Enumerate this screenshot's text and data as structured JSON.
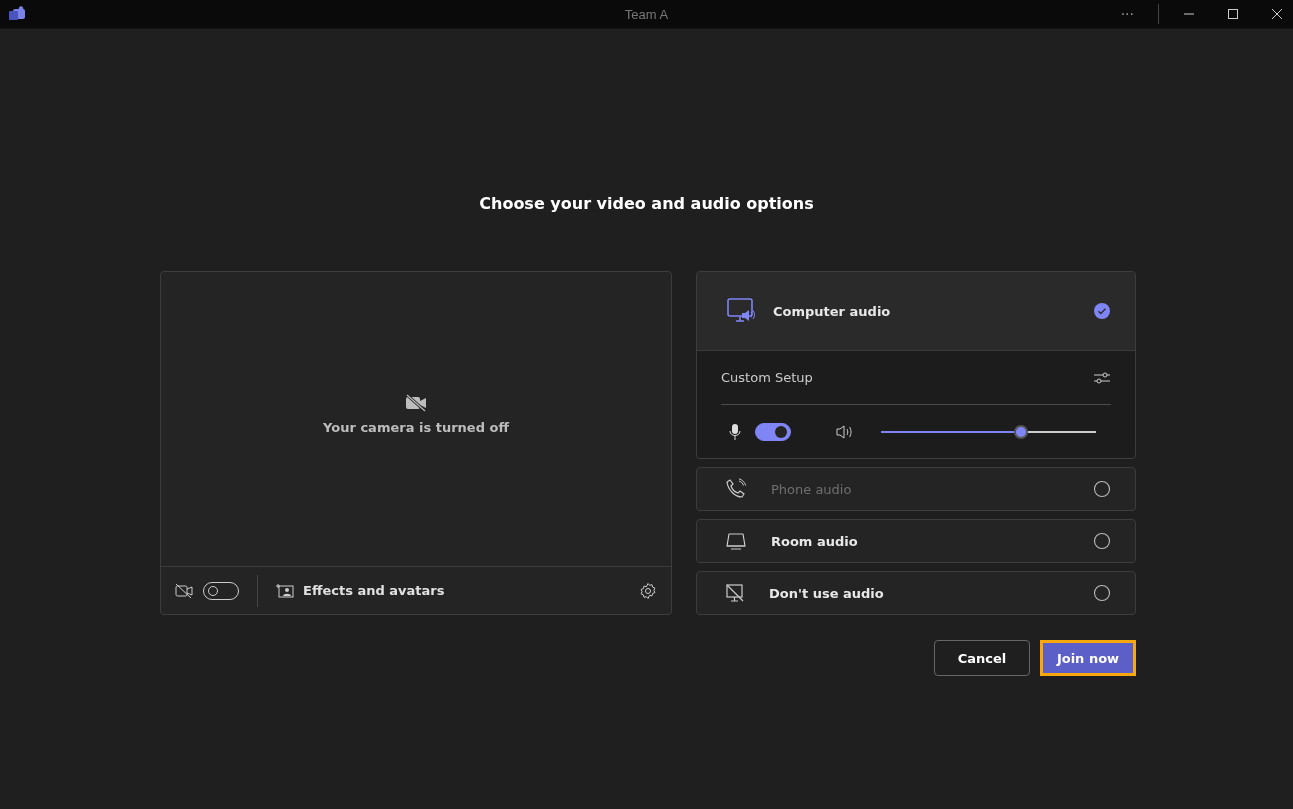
{
  "window": {
    "title": "Team A",
    "more": "···"
  },
  "heading": "Choose your video and audio options",
  "camera": {
    "message": "Your camera is turned off",
    "camera_on": false,
    "effects_label": "Effects and avatars"
  },
  "audio_options": [
    {
      "kind": "computer",
      "label": "Computer audio",
      "selected": true,
      "disabled": false,
      "expanded": true
    },
    {
      "kind": "phone",
      "label": "Phone audio",
      "selected": false,
      "disabled": true,
      "expanded": false
    },
    {
      "kind": "room",
      "label": "Room audio",
      "selected": false,
      "disabled": false,
      "expanded": false
    },
    {
      "kind": "none",
      "label": "Don't use audio",
      "selected": false,
      "disabled": false,
      "expanded": false
    }
  ],
  "custom_setup": {
    "label": "Custom Setup",
    "mic_on": true,
    "volume": {
      "level": 0.65
    }
  },
  "buttons": [
    {
      "kind": "secondary",
      "label": "Cancel",
      "focused": false
    },
    {
      "kind": "primary",
      "label": "Join now",
      "focused": true
    }
  ]
}
